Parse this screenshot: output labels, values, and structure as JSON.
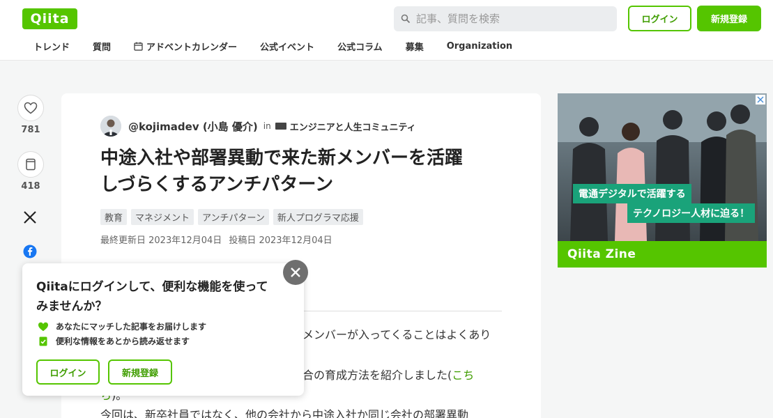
{
  "header": {
    "logo_text": "Qiita",
    "search_placeholder": "記事、質問を検索",
    "login_label": "ログイン",
    "signup_label": "新規登録",
    "nav": [
      {
        "label": "トレンド"
      },
      {
        "label": "質問"
      },
      {
        "label": "アドベントカレンダー",
        "icon": "calendar-icon"
      },
      {
        "label": "公式イベント"
      },
      {
        "label": "公式コラム"
      },
      {
        "label": "募集"
      },
      {
        "label": "Organization"
      }
    ]
  },
  "actions": {
    "like_count": "781",
    "stock_count": "418"
  },
  "article": {
    "author": "@kojimadev (小島 優介)",
    "in_label": "in",
    "organization": "エンジニアと人生コミュニティ",
    "title_line1": "中途入社や部署異動で来た新メンバーを活躍",
    "title_line2": "しづらくするアンチパターン",
    "tags": [
      "教育",
      "マネジメント",
      "アンチパターン",
      "新人プログラマ応援"
    ],
    "updated": "最終更新日 2023年12月04日",
    "posted": "投稿日 2023年12月04日",
    "body_line1": "メンバーが入ってくることはよくあり",
    "body_line2_text": "合の育成方法を紹介しました(",
    "body_line2_link": "こち",
    "body_line3_link": "ら",
    "body_line3_text": ")。",
    "body_line4": "今回は、新卒社員ではなく、他の会社から中途入社か同じ会社の部署異動"
  },
  "ad": {
    "band1": "電通デジタルで活躍する",
    "band2": "テクノロジー人材に迫る！",
    "footer": "Qiita Zine"
  },
  "popup": {
    "title": "Qiitaにログインして、便利な機能を使ってみませんか？",
    "feature1": "あなたにマッチした記事をお届けします",
    "feature2": "便利な情報をあとから読み返せます",
    "login_label": "ログイン",
    "signup_label": "新規登録"
  },
  "colors": {
    "brand": "#55c500",
    "brand_dark": "#3f9d00"
  }
}
